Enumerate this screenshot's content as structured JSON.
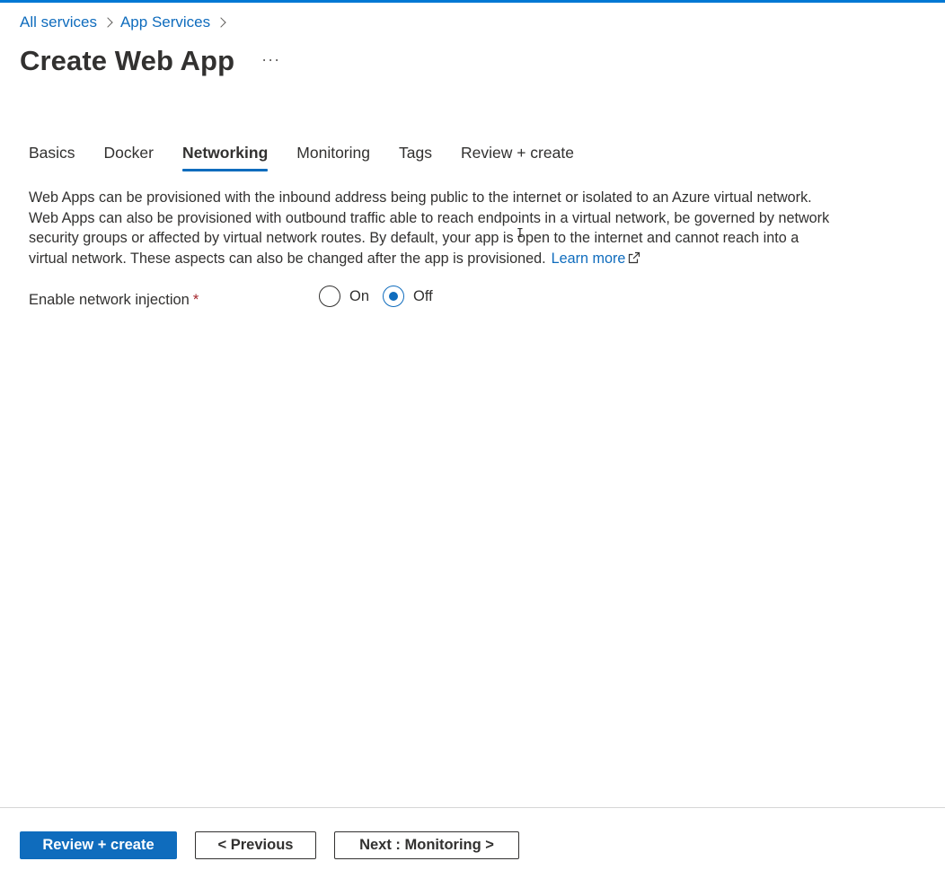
{
  "breadcrumb": {
    "items": [
      {
        "label": "All services"
      },
      {
        "label": "App Services"
      }
    ]
  },
  "page": {
    "title": "Create Web App",
    "more_label": "···"
  },
  "tabs": [
    {
      "label": "Basics",
      "active": false
    },
    {
      "label": "Docker",
      "active": false
    },
    {
      "label": "Networking",
      "active": true
    },
    {
      "label": "Monitoring",
      "active": false
    },
    {
      "label": "Tags",
      "active": false
    },
    {
      "label": "Review + create",
      "active": false
    }
  ],
  "description": {
    "text": "Web Apps can be provisioned with the inbound address being public to the internet or isolated to an Azure virtual network. Web Apps can also be provisioned with outbound traffic able to reach endpoints in a virtual network, be governed by network security groups or affected by virtual network routes. By default, your app is open to the internet and cannot reach into a virtual network. These aspects can also be changed after the app is provisioned.",
    "learn_more": "Learn more"
  },
  "network_injection": {
    "label": "Enable network injection",
    "required_mark": "*",
    "options": [
      {
        "label": "On",
        "selected": false
      },
      {
        "label": "Off",
        "selected": true
      }
    ]
  },
  "cursor_glyph": "I",
  "footer": {
    "review_create": "Review + create",
    "previous": "< Previous",
    "next": "Next : Monitoring >"
  },
  "colors": {
    "accent": "#0f6cbd",
    "required": "#a4262c",
    "text": "#323130"
  }
}
